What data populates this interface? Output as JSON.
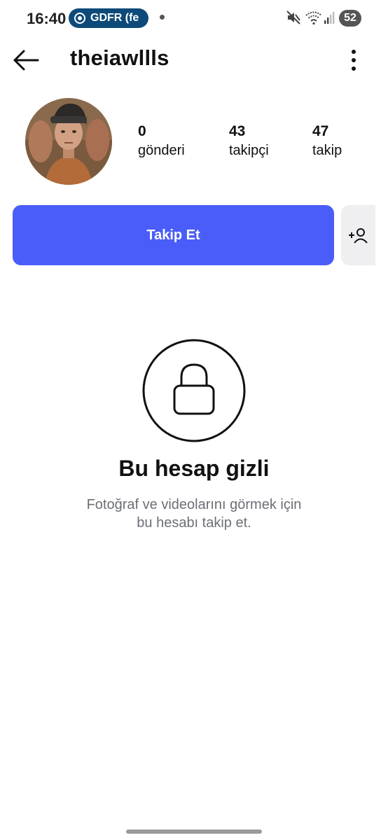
{
  "status_bar": {
    "time": "16:40",
    "notification_text": "GDFR (fe",
    "battery": "52"
  },
  "header": {
    "username": "theiawllls"
  },
  "stats": {
    "posts": {
      "count": "0",
      "label": "gönderi"
    },
    "followers": {
      "count": "43",
      "label": "takipçi"
    },
    "following": {
      "count": "47",
      "label": "takip"
    }
  },
  "actions": {
    "follow_label": "Takip Et"
  },
  "private_notice": {
    "title": "Bu hesap gizli",
    "subtitle_line1": "Fotoğraf ve videolarını görmek için",
    "subtitle_line2": "bu hesabı takip et."
  },
  "icons": {
    "back": "arrow-left-icon",
    "more": "more-vertical-icon",
    "suggest": "add-person-icon",
    "lock": "lock-icon",
    "mute": "muted-icon",
    "wifi": "wifi-icon",
    "signal": "signal-icon"
  },
  "colors": {
    "primary_button": "#4a5df9",
    "secondary_button": "#efeff2",
    "notification_pill": "#0d4a7a",
    "subtitle_text": "#6b6f75"
  }
}
